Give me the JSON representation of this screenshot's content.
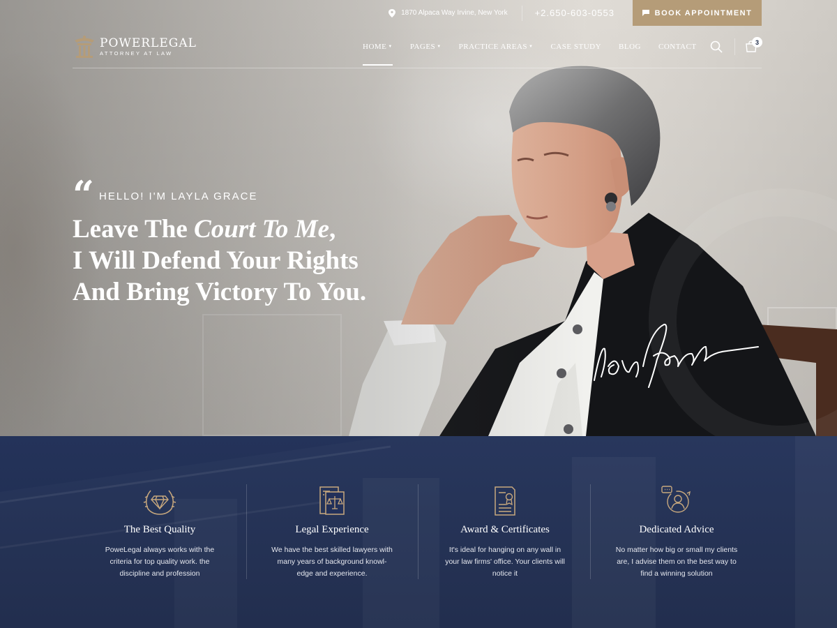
{
  "topbar": {
    "address": "1870 Alpaca Way Irvine, New York",
    "phone": "+2.650-603-0553",
    "book_label": "BOOK APPOINTMENT"
  },
  "brand": {
    "name": "POWERLEGAL",
    "tagline": "ATTORNEY AT LAW"
  },
  "nav": {
    "items": [
      {
        "label": "HOME",
        "dropdown": true,
        "active": true
      },
      {
        "label": "PAGES",
        "dropdown": true
      },
      {
        "label": "PRACTICE AREAS",
        "dropdown": true
      },
      {
        "label": "CASE STUDY"
      },
      {
        "label": "BLOG"
      },
      {
        "label": "CONTACT"
      }
    ],
    "cart_count": "3"
  },
  "hero": {
    "intro": "HELLO! I'M LAYLA GRACE",
    "line1_a": "Leave The ",
    "line1_em": "Court To Me",
    "line1_b": ",",
    "line2": "I Will Defend Your Rights",
    "line3": "And Bring Victory To You."
  },
  "features": [
    {
      "icon": "laurel-diamond-icon",
      "title": "The Best Quality",
      "desc": [
        "PoweLegal always works with the",
        "criteria for top quality work. the",
        "discipline and profession"
      ]
    },
    {
      "icon": "legal-document-icon",
      "title": "Legal Experience",
      "desc": [
        "We have the best skilled lawyers with",
        "many years of background knowl-",
        "edge and experience."
      ]
    },
    {
      "icon": "certificate-icon",
      "title": "Award & Certificates",
      "desc": [
        "It's ideal for hanging on any wall in",
        "your law firms' office. Your clients will",
        "notice it"
      ]
    },
    {
      "icon": "advisor-chat-icon",
      "title": "Dedicated Advice",
      "desc": [
        "No matter how big or small my clients",
        "are, I advise them on the best way to",
        "find a winning solution"
      ]
    }
  ],
  "colors": {
    "accent": "#b59c78",
    "navy": "#1e2a47",
    "white": "#ffffff"
  }
}
